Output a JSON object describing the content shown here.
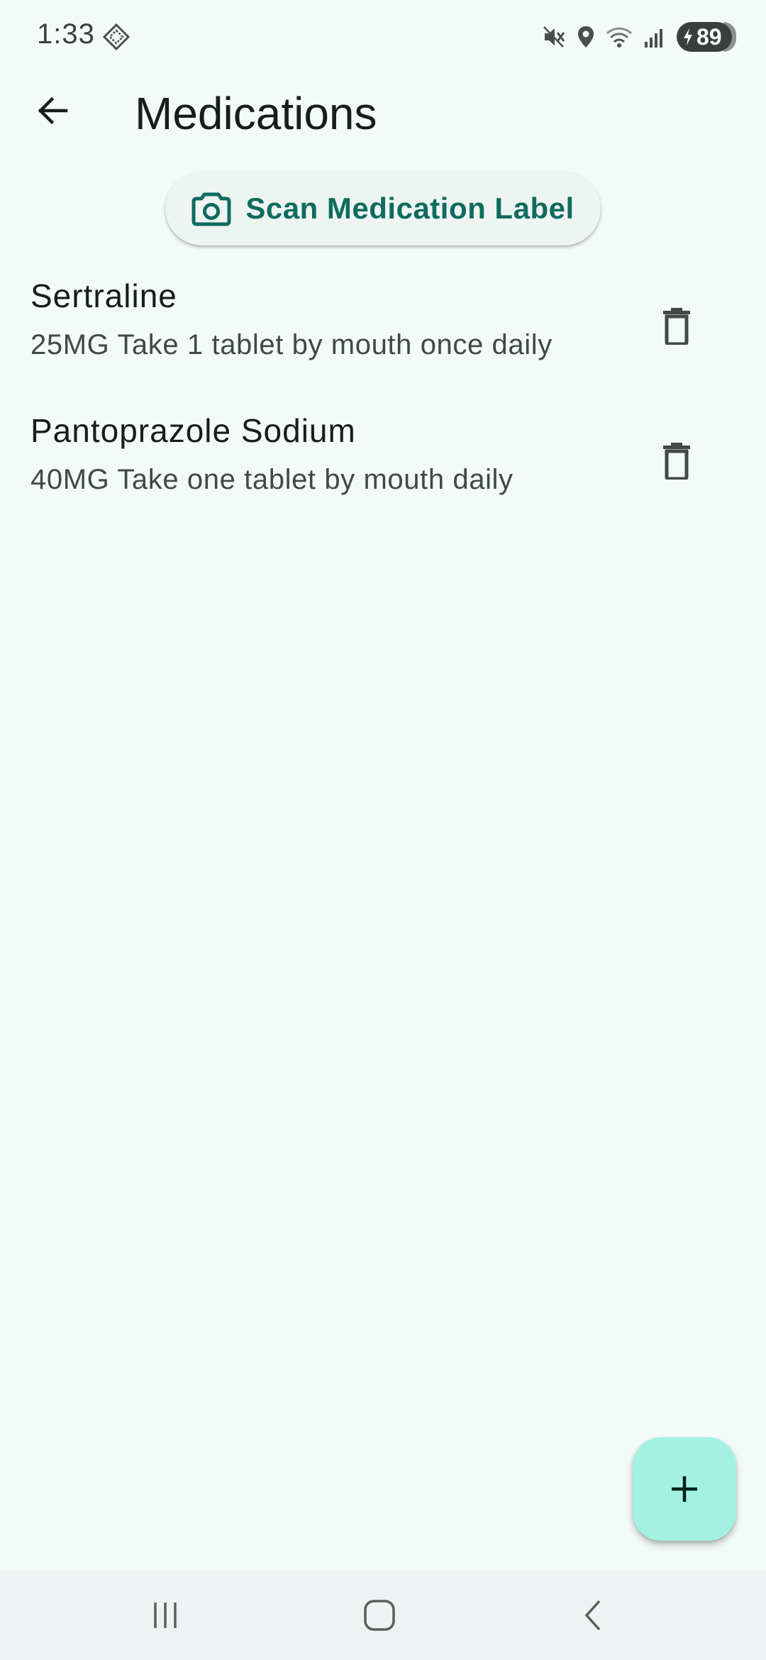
{
  "status_bar": {
    "time": "1:33",
    "battery_level": "89",
    "icons": [
      "notification-diamond-icon",
      "mute-icon",
      "location-icon",
      "wifi-icon",
      "signal-icon",
      "battery-charging-icon"
    ]
  },
  "app_bar": {
    "title": "Medications",
    "back_icon": "arrow-back-icon"
  },
  "scan_button": {
    "label": "Scan Medication Label",
    "icon": "camera-icon"
  },
  "medications": [
    {
      "name": "Sertraline",
      "details": "25MG Take 1 tablet by mouth once daily",
      "action_icon": "delete-icon"
    },
    {
      "name": "Pantoprazole Sodium",
      "details": "40MG Take one tablet by mouth daily",
      "action_icon": "delete-icon"
    }
  ],
  "fab": {
    "icon": "plus-icon"
  },
  "navigation_bar": {
    "buttons": [
      "recent-apps-icon",
      "home-icon",
      "back-icon"
    ]
  },
  "colors": {
    "background": "#f4faf8",
    "accent": "#0f6b60",
    "fab": "#a3f1e2",
    "text_primary": "#171d1b",
    "text_secondary": "#3f4946"
  }
}
